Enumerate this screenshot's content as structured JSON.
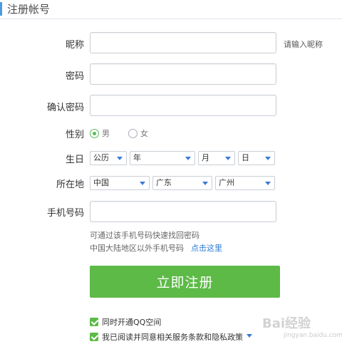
{
  "header": {
    "title": "注册帐号"
  },
  "form": {
    "nickname": {
      "label": "昵称",
      "hint": "请输入昵称",
      "value": ""
    },
    "password": {
      "label": "密码",
      "value": ""
    },
    "confirm_password": {
      "label": "确认密码",
      "value": ""
    },
    "gender": {
      "label": "性别",
      "male": "男",
      "female": "女",
      "selected": "男"
    },
    "birthday": {
      "label": "生日",
      "calendar": "公历",
      "year": "年",
      "month": "月",
      "day": "日"
    },
    "location": {
      "label": "所在地",
      "country": "中国",
      "province": "广东",
      "city": "广州"
    },
    "phone": {
      "label": "手机号码",
      "value": ""
    },
    "phone_note1": "可通过该手机号码快速找回密码",
    "phone_note2": "中国大陆地区以外手机号码",
    "phone_link": "点击这里"
  },
  "register_button": "立即注册",
  "checks": {
    "qzone": "同时开通QQ空间",
    "agree": "我已阅读并同意相关服务条款和隐私政策"
  },
  "watermark": {
    "text": "Bai经验",
    "sub": "jingyan.baidu.com"
  },
  "colors": {
    "accent": "#4a9be0",
    "button": "#5dba47",
    "link": "#2e7bd6"
  }
}
